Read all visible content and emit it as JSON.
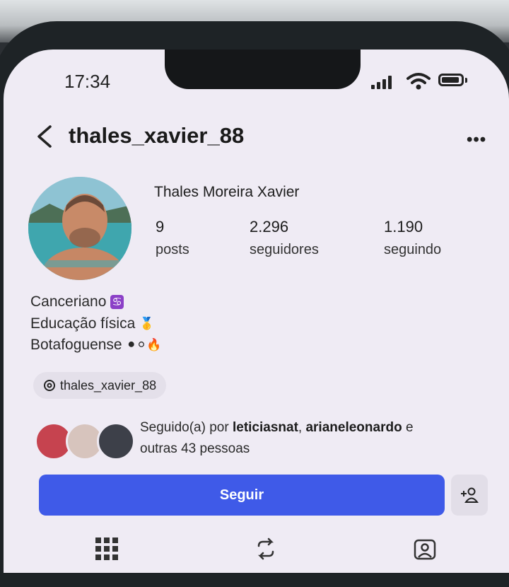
{
  "status_bar": {
    "time": "17:34"
  },
  "header": {
    "username": "thales_xavier_88"
  },
  "profile": {
    "full_name": "Thales Moreira Xavier",
    "stats": [
      {
        "value": "9",
        "label": "posts"
      },
      {
        "value": "2.296",
        "label": "seguidores"
      },
      {
        "value": "1.190",
        "label": "seguindo"
      }
    ],
    "bio": [
      {
        "text": "Canceriano",
        "emoji": "♋"
      },
      {
        "text": "Educação física",
        "emoji": "🥇"
      },
      {
        "text": "Botafoguense",
        "emoji": "⚫⚪🔥"
      }
    ],
    "threads_handle": "thales_xavier_88"
  },
  "followed_by": {
    "prefix": "Seguido(a) por ",
    "users": [
      "leticiasnat",
      "arianeleonardo"
    ],
    "suffix_1": " e",
    "suffix_2": "outras 43 pessoas",
    "separator": ", "
  },
  "actions": {
    "follow_label": "Seguir"
  },
  "colors": {
    "accent": "#3f5ae8",
    "background": "#efebf4"
  },
  "icons": [
    "back-chevron-icon",
    "more-options-icon",
    "threads-icon",
    "add-person-icon",
    "grid-icon",
    "reels-repost-icon",
    "tagged-icon"
  ]
}
